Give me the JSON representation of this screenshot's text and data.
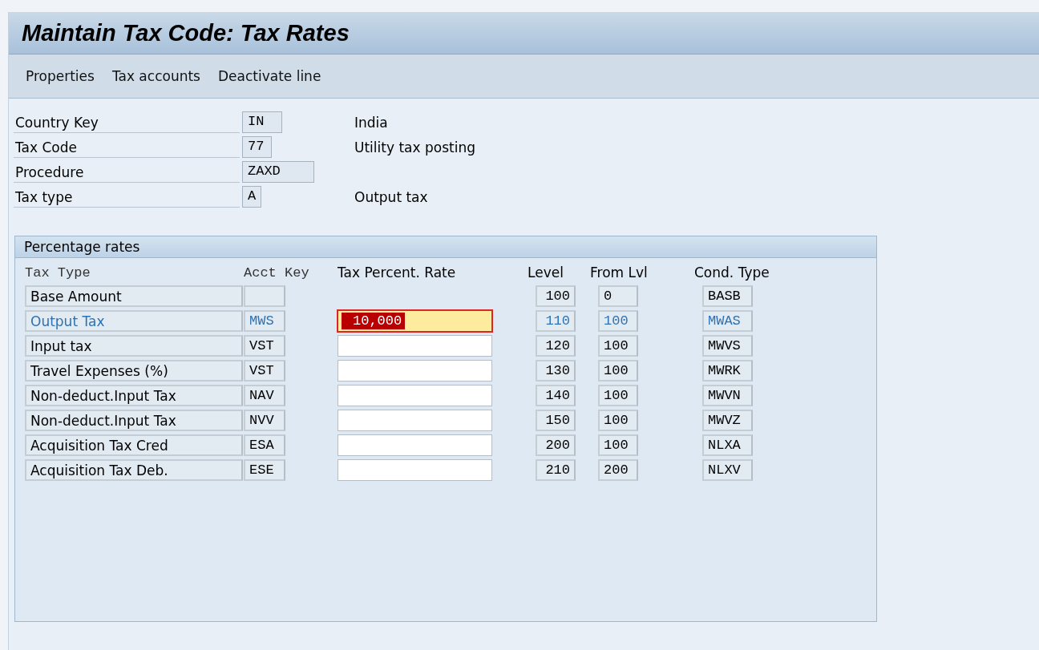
{
  "title": "Maintain Tax Code: Tax Rates",
  "toolbar": [
    "Properties",
    "Tax accounts",
    "Deactivate line"
  ],
  "header_fields": [
    {
      "label": "Country Key",
      "value": "IN",
      "description": "India"
    },
    {
      "label": "Tax Code",
      "value": "77",
      "description": "Utility tax posting"
    },
    {
      "label": "Procedure",
      "value": "ZAXD"
    },
    {
      "label": "Tax type",
      "value": "A",
      "description": "Output tax"
    }
  ],
  "percentage_rates": {
    "title": "Percentage rates",
    "columns": [
      "Tax Type",
      "Acct Key",
      "Tax Percent. Rate",
      "Level",
      "From Lvl",
      "Cond. Type"
    ],
    "rows": [
      {
        "kind": "base",
        "tax_type": "Base Amount",
        "selected": false,
        "level": "100",
        "from_lvl": "0",
        "cond_type": "BASB"
      },
      {
        "kind": "rate",
        "tax_type": "Output Tax",
        "acct_key": "MWS",
        "rate": "10,000",
        "focused": true,
        "selected": true,
        "level": "110",
        "from_lvl": "100",
        "cond_type": "MWAS"
      },
      {
        "kind": "rate",
        "tax_type": "Input tax",
        "acct_key": "VST",
        "focused": false,
        "selected": false,
        "level": "120",
        "from_lvl": "100",
        "cond_type": "MWVS"
      },
      {
        "kind": "rate",
        "tax_type": "Travel Expenses (%)",
        "acct_key": "VST",
        "focused": false,
        "selected": false,
        "level": "130",
        "from_lvl": "100",
        "cond_type": "MWRK"
      },
      {
        "kind": "rate",
        "tax_type": "Non-deduct.Input Tax",
        "acct_key": "NAV",
        "focused": false,
        "selected": false,
        "level": "140",
        "from_lvl": "100",
        "cond_type": "MWVN"
      },
      {
        "kind": "rate",
        "tax_type": "Non-deduct.Input Tax",
        "acct_key": "NVV",
        "focused": false,
        "selected": false,
        "level": "150",
        "from_lvl": "100",
        "cond_type": "MWVZ"
      },
      {
        "kind": "rate",
        "tax_type": "Acquisition Tax Cred",
        "acct_key": "ESA",
        "focused": false,
        "selected": false,
        "level": "200",
        "from_lvl": "100",
        "cond_type": "NLXA"
      },
      {
        "kind": "rate",
        "tax_type": "Acquisition Tax Deb.",
        "acct_key": "ESE",
        "focused": false,
        "selected": false,
        "level": "210",
        "from_lvl": "200",
        "cond_type": "NLXV"
      }
    ]
  }
}
